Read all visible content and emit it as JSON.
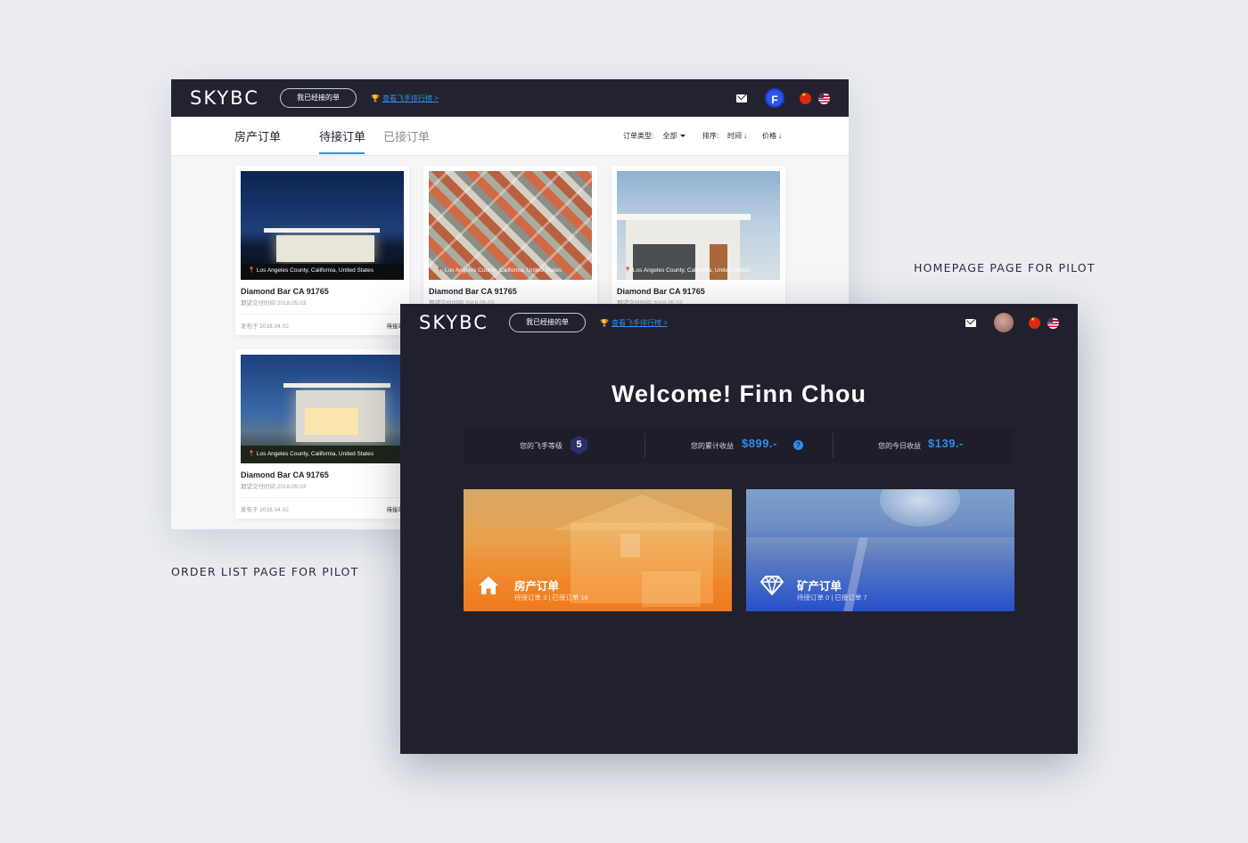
{
  "captions": {
    "homepage": "HOMEPAGE PAGE FOR PILOT",
    "order_list": "ORDER LIST PAGE FOR PILOT"
  },
  "header": {
    "logo": "SKYBC",
    "my_orders_button": "我已经接的单",
    "rank_link": "查看飞手排行榜 >",
    "avatar_letter": "F"
  },
  "order_list": {
    "tabs": [
      "房产订单",
      "待接订单",
      "已接订单"
    ],
    "active_tab": "待接订单",
    "filters": {
      "type_label": "订单类型:",
      "type_value": "全部",
      "sort_label": "排序:",
      "sort_time": "时间",
      "sort_price": "价格"
    },
    "cards": [
      {
        "location": "Los Angeles County, California, United States",
        "title": "Diamond Bar CA 91765",
        "delivery": "期望交付时间 2018.05.03",
        "published": "发布于 2018.04.02",
        "status": "待接单"
      },
      {
        "location": "Los Angeles County, California, United States",
        "title": "Diamond Bar CA 91765",
        "delivery": "期望交付时间 2018.05.03",
        "published": "",
        "status": ""
      },
      {
        "location": "Los Angeles County, California, United States",
        "title": "Diamond Bar CA 91765",
        "delivery": "期望交付时间 2018.05.03",
        "published": "",
        "status": ""
      },
      {
        "location": "Los Angeles County, California, United States",
        "title": "Diamond Bar CA 91765",
        "delivery": "期望交付时间 2018.05.03",
        "published": "发布于 2018.04.02",
        "status": "待接单"
      }
    ]
  },
  "home": {
    "welcome": "Welcome! Finn Chou",
    "stats": {
      "level_label": "您的飞手等级",
      "level_value": "5",
      "total_label": "您的累计收益",
      "total_value": "$899.-",
      "today_label": "您的今日收益",
      "today_value": "$139.-"
    },
    "cards": [
      {
        "title": "房产订单",
        "subtitle": "待接订单 3 | 已接订单 16",
        "icon": "house-icon"
      },
      {
        "title": "矿产订单",
        "subtitle": "待接订单 0 | 已接订单 7",
        "icon": "diamond-icon"
      }
    ]
  },
  "colors": {
    "accent": "#2f8ef0",
    "topbar": "#22232f",
    "home_bg": "#20212d",
    "house_card": "#f0872a",
    "mine_card": "#2550cc"
  }
}
